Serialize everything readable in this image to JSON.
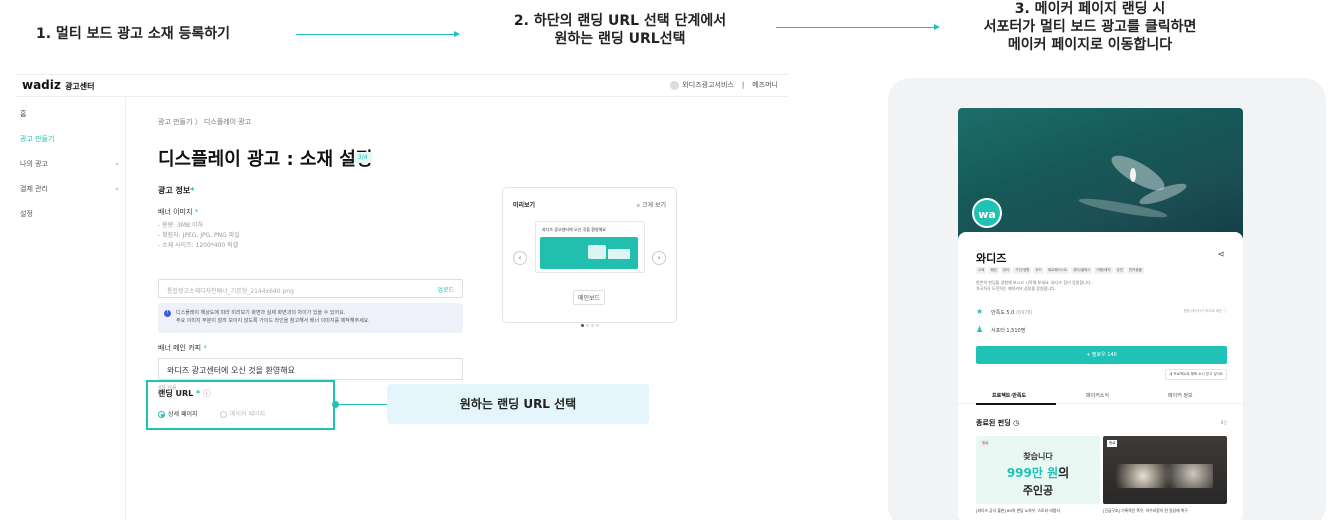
{
  "steps": {
    "step1": "1. 멀티 보드 광고 소재 등록하기",
    "step2_line1": "2. 하단의 랜딩 URL 선택 단계에서",
    "step2_line2": "원하는 랜딩 URL선택",
    "step3_line1": "3. 메이커 페이지 랜딩 시",
    "step3_line2": "서포터가 멀티 보드 광고를 클릭하면",
    "step3_line3": "메이커 페이지로 이동합니다"
  },
  "accent_color": "#1fc2b5",
  "admin": {
    "logo": "wadiz",
    "logo_sub": "광고센터",
    "header_right": [
      "와디즈광고서비스",
      "메즈머니"
    ],
    "sidebar": [
      {
        "label": "홈",
        "has_chevron": false,
        "active": false
      },
      {
        "label": "광고 만들기",
        "has_chevron": false,
        "active": true
      },
      {
        "label": "나의 광고",
        "has_chevron": true,
        "active": false
      },
      {
        "label": "결제 관리",
        "has_chevron": true,
        "active": false
      },
      {
        "label": "설정",
        "has_chevron": false,
        "active": false
      }
    ],
    "breadcrumb": "광고 만들기  〉 디스플레이 광고",
    "page_title": "디스플레이 광고 : 소재 설정",
    "step_badge": "3/4",
    "section_title": "광고 정보",
    "banner_image_label": "배너 이미지",
    "banner_hints": [
      "- 용량: 3MB 이하",
      "- 확장자: JPEG, JPG, PNG 파일",
      "- 소재 사이즈: 1200*400 픽셀"
    ],
    "file_name": "통합광고소재디자인배너_기본형_2144x640.png",
    "upload_label": "업로드",
    "notice_line1": "디스플레이 해상도에 따라 미리보기 화면과 실제 화면과의 차이가 있을 수 있어요.",
    "notice_line2": "주요 이미지 부분이 잘려 보이지 않도록 가이드 라인을 참고해서 배너 이미지를 제작해주세요.",
    "copy_label": "배너 메인 카피",
    "copy_value": "와디즈 광고센터에 오신 것을 환영해요",
    "copy_counter": "4자 남음",
    "preview": {
      "title": "미리보기",
      "zoom": "크게 보기",
      "banner_text": "와디즈 광고센터에 오신 것을 환영해요",
      "label": "메인보드"
    },
    "landing_title": "랜딩 URL",
    "landing_options": [
      "상세 페이지",
      "메이커 페이지"
    ],
    "landing_selected": 0,
    "callout": "원하는 랜딩 URL 선택"
  },
  "maker_page": {
    "logo": "wa",
    "name": "와디즈",
    "tags": [
      "교육",
      "패션",
      "뷰티",
      "가전/생활",
      "푸드",
      "제로웨이스트",
      "취미/클래스",
      "여행/레저",
      "공연",
      "반려동물"
    ],
    "desc_line1": "한번씩 펀딩을 경험해 보시고 시작해 보세요. 와디즈 팀이 응원합니다.",
    "desc_line2": "차곡차곡 도전하는 메이커의 성장을 응원합니다.",
    "rating": "만족도 5.0",
    "rating_count": "(6978)",
    "rating_right": "평점 데이터가 보여요 확인 ⓘ",
    "supporters": "서포터 1,510명",
    "follow_button": "+ 팔로우 140",
    "mini_button": "새 프로젝트와 혜택 소식 받고 싶어요",
    "tabs": [
      "프로젝트·만족도",
      "메이커소식",
      "메이커 정보"
    ],
    "section": "종료된 펀딩",
    "more": "8건",
    "card1": {
      "badge": "종료",
      "sub": "찾습니다",
      "big_accent": "999만 원",
      "big_tail": "의",
      "last": "주인공",
      "caption": "[와디즈 공식 출판] 60억 펀딩 노하우, 스토리 비법서"
    },
    "card2": {
      "badge": "종료",
      "caption": "[긴급구호] 기록적인 폭우, 아수라장이 된 일상에 복구"
    }
  }
}
